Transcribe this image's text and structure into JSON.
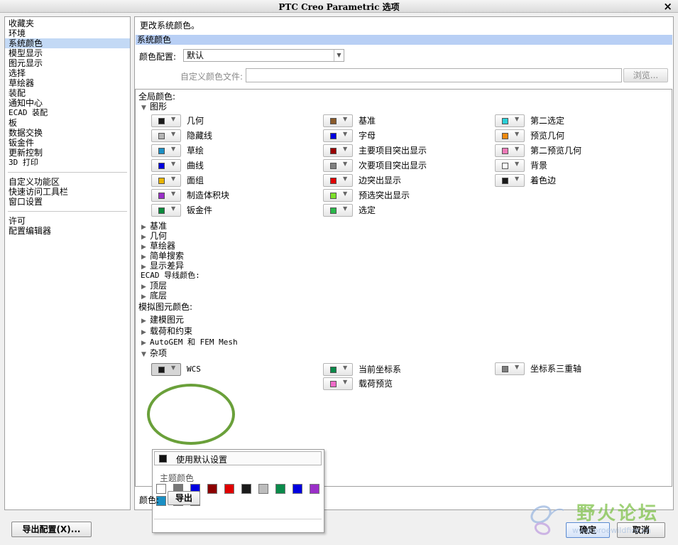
{
  "window": {
    "title": "PTC Creo Parametric 选项",
    "close_glyph": "×"
  },
  "nav": {
    "group1": [
      "收藏夹",
      "环境",
      "系统颜色",
      "模型显示",
      "图元显示",
      "选择",
      "草绘器",
      "装配",
      "通知中心",
      "ECAD 装配",
      "板",
      "数据交换",
      "钣金件",
      "更新控制",
      "3D 打印"
    ],
    "group2": [
      "自定义功能区",
      "快速访问工具栏",
      "窗口设置"
    ],
    "group3": [
      "许可",
      "配置编辑器"
    ],
    "selected": "系统颜色"
  },
  "main": {
    "heading": "更改系统颜色。",
    "section": "系统颜色",
    "color_config_label": "颜色配置:",
    "color_config_value": "默认",
    "custom_file_label": "自定义颜色文件:",
    "custom_file_value": "",
    "browse_label": "浏览...",
    "global_colors_label": "全局颜色:",
    "graphics_label": "图形",
    "collapsed_groups": [
      "基准",
      "几何",
      "草绘器",
      "简单搜索",
      "显示差异"
    ],
    "ecad_label": "ECAD 导线颜色:",
    "ecad_items": [
      "顶层",
      "底层"
    ],
    "sim_label": "模拟图元颜色:",
    "sim_items": [
      "建模图元",
      "载荷和约束",
      "AutoGEM 和 FEM Mesh"
    ],
    "misc_label": "杂项",
    "footer_color_label": "颜色:",
    "export_label": "导出"
  },
  "graphics_colors": {
    "col1": [
      {
        "label": "几何",
        "color": "#1a1a1a"
      },
      {
        "label": "隐藏线",
        "color": "#b4b4b4"
      },
      {
        "label": "草绘",
        "color": "#1a8fc4"
      },
      {
        "label": "曲线",
        "color": "#0000e0"
      },
      {
        "label": "面组",
        "color": "#e8b400"
      },
      {
        "label": "制造体积块",
        "color": "#9a2fc8"
      },
      {
        "label": "钣金件",
        "color": "#0a8a3c"
      }
    ],
    "col2": [
      {
        "label": "基准",
        "color": "#8a5a2a"
      },
      {
        "label": "字母",
        "color": "#0000e0"
      },
      {
        "label": "主要项目突出显示",
        "color": "#9a0000"
      },
      {
        "label": "次要项目突出显示",
        "color": "#808080"
      },
      {
        "label": "边突出显示",
        "color": "#e00000"
      },
      {
        "label": "预选突出显示",
        "color": "#7de02a"
      },
      {
        "label": "选定",
        "color": "#2ab84a"
      }
    ],
    "col3": [
      {
        "label": "第二选定",
        "color": "#2ad0d8"
      },
      {
        "label": "预览几何",
        "color": "#f08a10"
      },
      {
        "label": "第二预览几何",
        "color": "#f07ab8"
      },
      {
        "label": "背景",
        "color": "#ffffff"
      },
      {
        "label": "着色边",
        "color": "#1a1a1a"
      }
    ]
  },
  "misc_colors": [
    {
      "label": "WCS",
      "color": "#1a1a1a"
    },
    {
      "label": "当前坐标系",
      "color": "#0a8a4a"
    },
    {
      "label": "坐标系三重轴",
      "color": "#808080"
    },
    {
      "label": "载荷预览",
      "color": "#f06ac8"
    }
  ],
  "popup": {
    "use_default_label": "使用默认设置",
    "theme_colors_label": "主题颜色",
    "theme_colors": [
      "#ffffff",
      "#777777",
      "#0000e0",
      "#8c0000",
      "#e00000",
      "#1a1a1a",
      "#bcbcbc",
      "#0a8a4a",
      "#0000e0",
      "#9a2fc8",
      "#1a8fc4",
      "#8a5a2a",
      "#e8b400"
    ]
  },
  "footer": {
    "export_config_label": "导出配置(X)...",
    "ok_label": "确定",
    "cancel_label": "取消"
  },
  "watermark": {
    "text": "野火论坛",
    "url_text": "www.proewildfire.cn"
  }
}
